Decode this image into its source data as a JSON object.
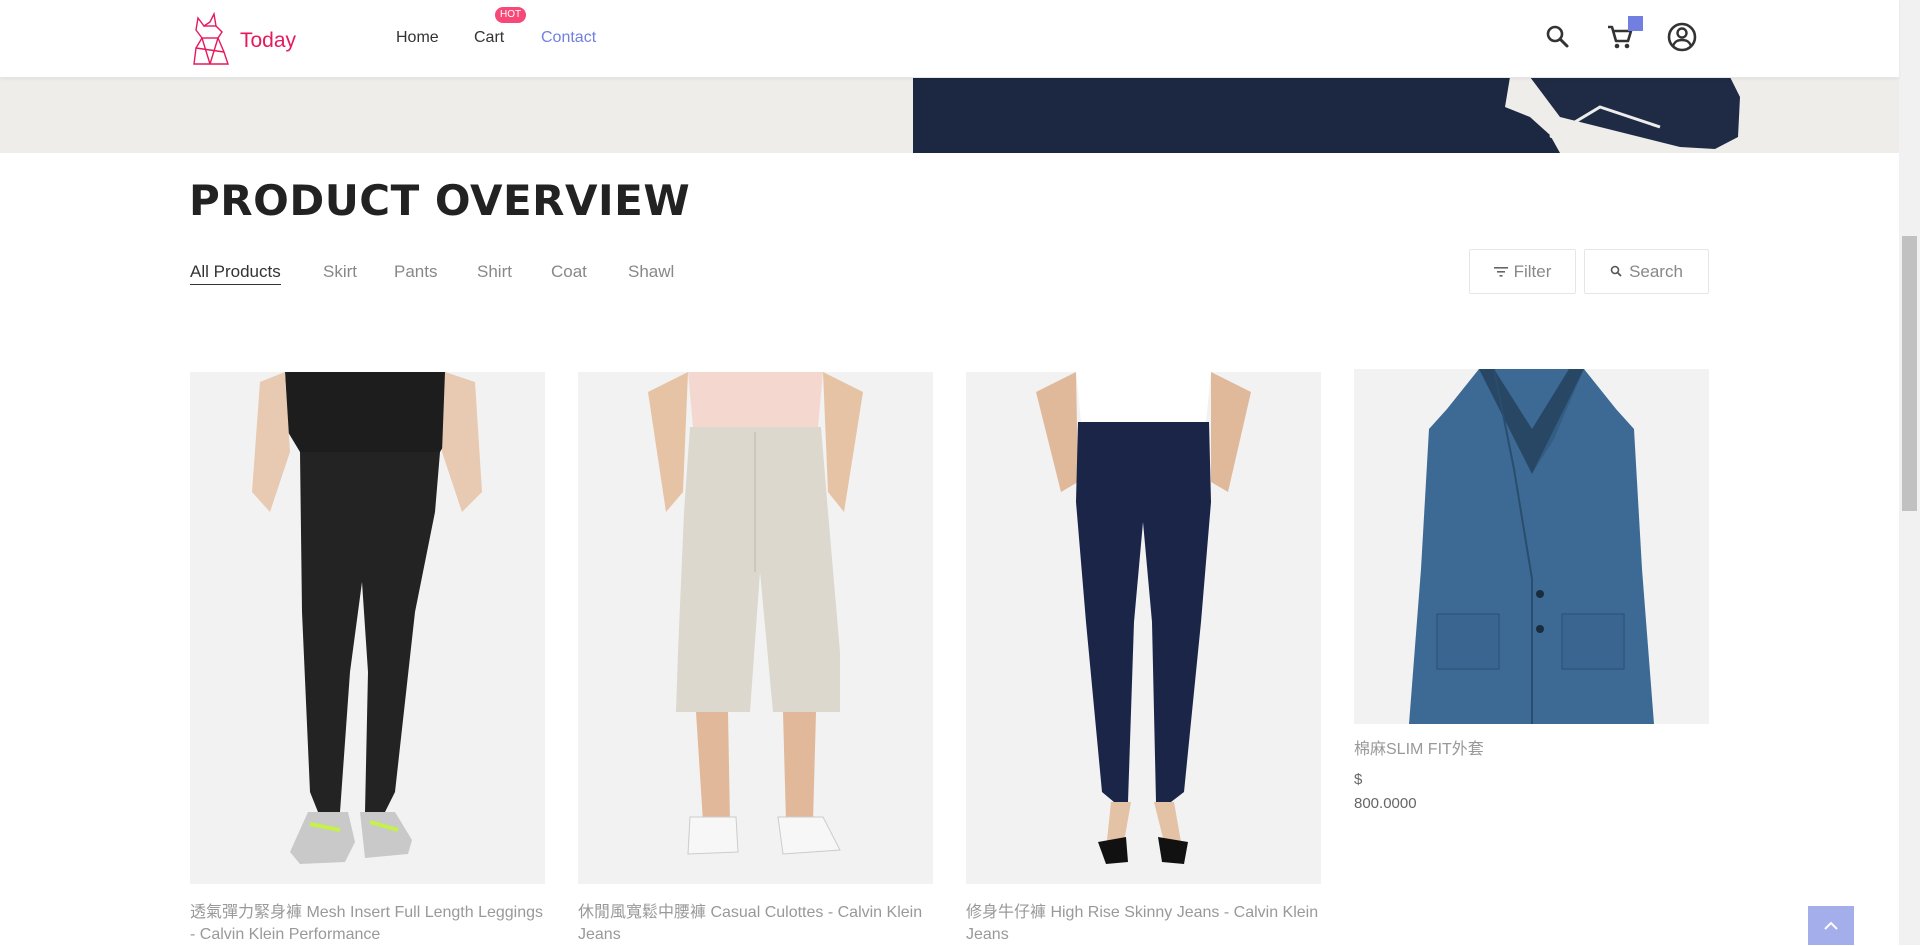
{
  "header": {
    "brand": "Today",
    "nav": [
      {
        "label": "Home"
      },
      {
        "label": "Cart"
      },
      {
        "label": "Contact"
      }
    ],
    "hot_badge": "HOT",
    "icons": [
      "search-icon",
      "cart-icon",
      "account-icon"
    ],
    "accent": "#717fe0",
    "brand_color": "#e5195c"
  },
  "overview": {
    "title": "PRODUCT OVERVIEW",
    "tabs": [
      "All Products",
      "Skirt",
      "Pants",
      "Shirt",
      "Coat",
      "Shawl"
    ],
    "filter_label": "Filter",
    "search_label": "Search"
  },
  "products": [
    {
      "name": "透氣彈力緊身褲 Mesh Insert Full Length Leggings - Calvin Klein Performance"
    },
    {
      "name": "休閒風寬鬆中腰褲 Casual Culottes - Calvin Klein Jeans"
    },
    {
      "name": "修身牛仔褲 High Rise Skinny Jeans - Calvin Klein Jeans"
    },
    {
      "name": "棉麻SLIM FIT外套",
      "currency": "$",
      "price": "800.0000"
    }
  ]
}
